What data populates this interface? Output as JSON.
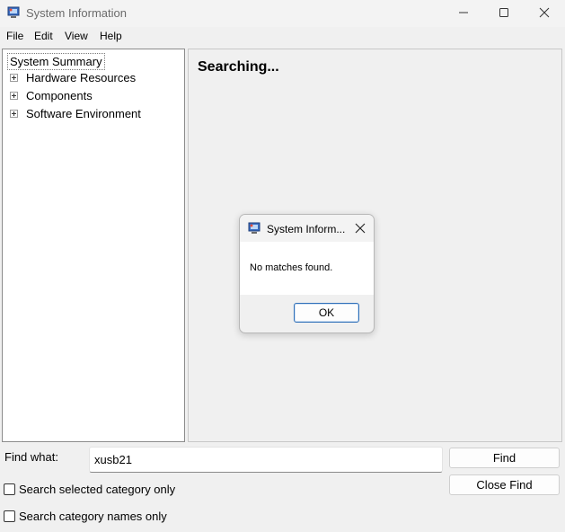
{
  "window": {
    "title": "System Information"
  },
  "menu": {
    "items": [
      "File",
      "Edit",
      "View",
      "Help"
    ]
  },
  "tree": {
    "root": "System Summary",
    "children": [
      "Hardware Resources",
      "Components",
      "Software Environment"
    ]
  },
  "details": {
    "status": "Searching..."
  },
  "dialog": {
    "title": "System Inform...",
    "message": "No matches found.",
    "ok_label": "OK"
  },
  "find": {
    "label": "Find what:",
    "value": "xusb21",
    "find_button": "Find",
    "close_button": "Close Find",
    "option_selected_category": "Search selected category only",
    "option_category_names": "Search category names only"
  },
  "icons": {
    "app": "system-information-icon",
    "minimize": "minimize-icon",
    "maximize": "maximize-icon",
    "close": "close-icon",
    "expand": "plus-expander-icon"
  }
}
